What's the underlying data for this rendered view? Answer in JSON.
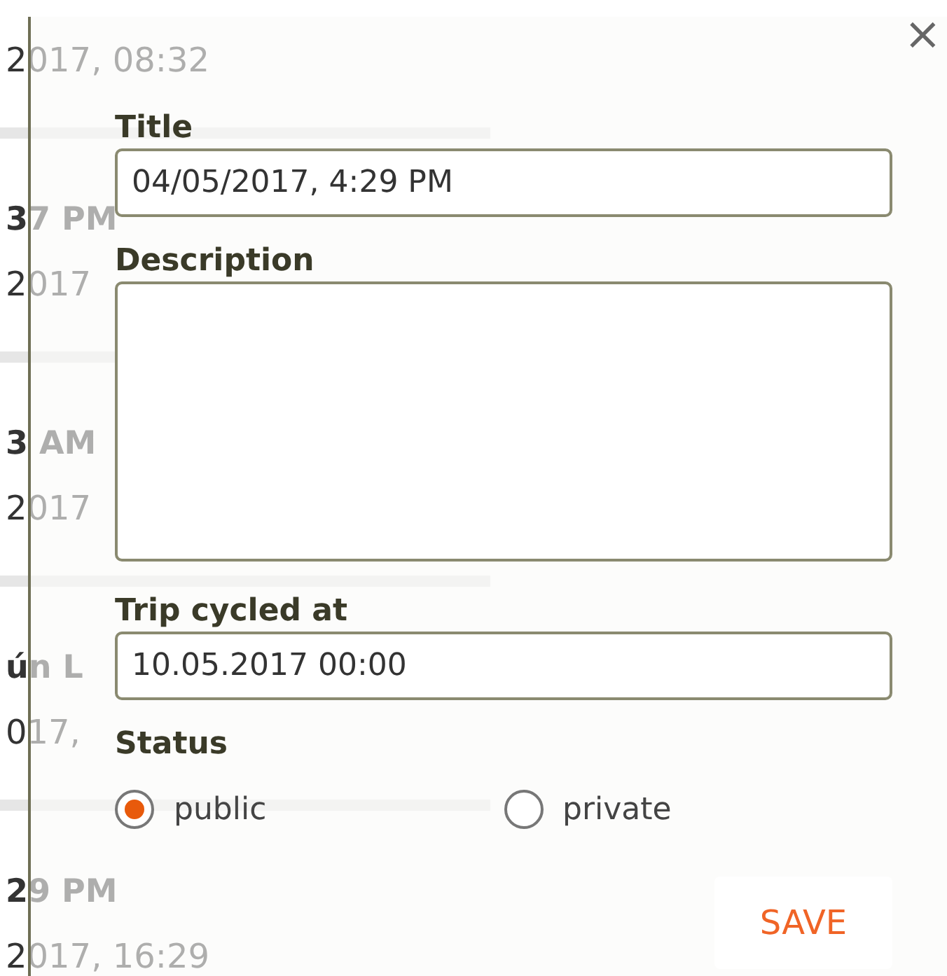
{
  "background_list": {
    "items": [
      {
        "date": "2017, 08:32"
      },
      {
        "time": "37 PM",
        "date": "2017"
      },
      {
        "time": "3 AM",
        "date": "2017"
      },
      {
        "time": "ún L",
        "date": "017,"
      },
      {
        "time": "29 PM",
        "date": "2017, 16:29"
      }
    ]
  },
  "dialog": {
    "close": "×",
    "fields": [
      {
        "label": "Title",
        "kind": "text",
        "value": "04/05/2017, 4:29 PM"
      },
      {
        "label": "Description",
        "kind": "textarea"
      },
      {
        "label": "Trip cycled at",
        "kind": "text",
        "value": "10.05.2017 00:00"
      }
    ],
    "status": {
      "label": "Status",
      "options": [
        {
          "label": "public",
          "selected": true
        },
        {
          "label": "private",
          "selected": false
        }
      ]
    },
    "save_button": "SAVE"
  }
}
